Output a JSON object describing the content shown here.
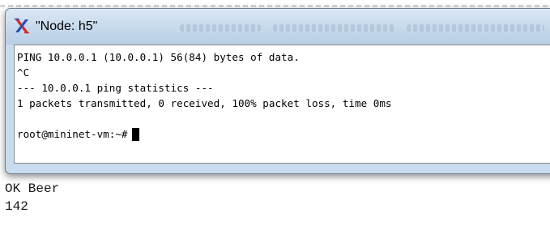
{
  "window": {
    "title": "\"Node: h5\""
  },
  "terminal": {
    "lines": [
      "PING 10.0.0.1 (10.0.0.1) 56(84) bytes of data.",
      "^C",
      "--- 10.0.0.1 ping statistics ---",
      "1 packets transmitted, 0 received, 100% packet loss, time 0ms",
      ""
    ],
    "prompt": "root@mininet-vm:~#"
  },
  "background_output": {
    "lines": [
      "OK Beer",
      "142"
    ]
  },
  "icons": {
    "app_icon": "x11-icon",
    "cursor": "block-cursor"
  },
  "colors": {
    "titlebar": "#c9dced",
    "terminal_bg": "#ffffff",
    "text": "#000000",
    "x_icon_red": "#d22a2a",
    "x_icon_blue": "#2a4fb0"
  }
}
